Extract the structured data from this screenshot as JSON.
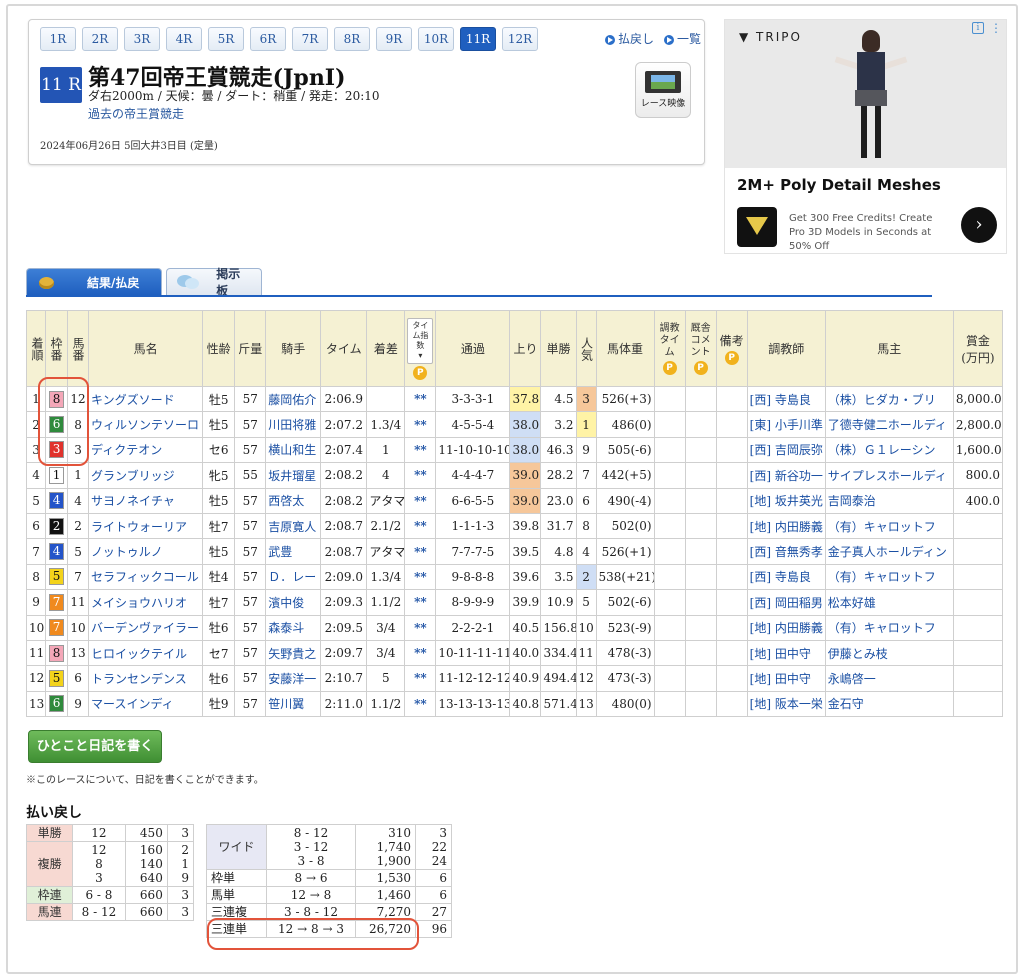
{
  "race_nav": {
    "tabs": [
      "1R",
      "2R",
      "3R",
      "4R",
      "5R",
      "6R",
      "7R",
      "8R",
      "9R",
      "10R",
      "11R",
      "12R"
    ],
    "active": "11R",
    "refund_link": "払戻し",
    "list_link": "一覧"
  },
  "race": {
    "badge": "11 R",
    "title": "第47回帝王賞競走(JpnI)",
    "info": "ダ右2000m / 天候：曇 / ダート：稍重 / 発走：20:10",
    "past_link": "過去の帝王賞競走",
    "date_line": "2024年06月26日 5回大井3日目 (定量)",
    "video_label": "レース映像"
  },
  "ad": {
    "brand": "TRIPO",
    "headline": "2M+ Poly Detail Meshes",
    "text": "Get 300 Free Credits! Create Pro 3D Models in Seconds at 50% Off",
    "go": "›"
  },
  "tabs": {
    "results": "結果/払戻",
    "board": "掲示板"
  },
  "table": {
    "headers": {
      "rank": "着順",
      "waku": "枠番",
      "uma": "馬番",
      "name": "馬名",
      "sex": "性齢",
      "weight": "斤量",
      "jockey": "騎手",
      "time": "タイム",
      "margin": "着差",
      "time_index": "タイム指数",
      "pass": "通過",
      "last": "上り",
      "odds": "単勝",
      "pop": "人気",
      "body": "馬体重",
      "train_time": "調教タイム",
      "stable_comment": "厩舎コメント",
      "note": "備考",
      "trainer": "調教師",
      "owner": "馬主",
      "prize": "賞金(万円)"
    },
    "rows": [
      {
        "rank": "1",
        "waku": "8",
        "uma": "12",
        "name": "キングズソード",
        "sex": "牡5",
        "kg": "57",
        "jockey": "藤岡佑介",
        "time": "2:06.9",
        "margin": "",
        "idx": "**",
        "pass": "3-3-3-1",
        "last": "37.8",
        "odds": "4.5",
        "pop": "3",
        "body": "526(+3)",
        "trainer": "[西] 寺島良",
        "owner": "（株）ヒダカ・ブリ",
        "prize": "8,000.0"
      },
      {
        "rank": "2",
        "waku": "6",
        "uma": "8",
        "name": "ウィルソンテソーロ",
        "sex": "牡5",
        "kg": "57",
        "jockey": "川田将雅",
        "time": "2:07.2",
        "margin": "1.3/4",
        "idx": "**",
        "pass": "4-5-5-4",
        "last": "38.0",
        "odds": "3.2",
        "pop": "1",
        "body": "486(0)",
        "trainer": "[東] 小手川準",
        "owner": "了德寺健二ホールディ",
        "prize": "2,800.0"
      },
      {
        "rank": "3",
        "waku": "3",
        "uma": "3",
        "name": "ディクテオン",
        "sex": "セ6",
        "kg": "57",
        "jockey": "横山和生",
        "time": "2:07.4",
        "margin": "1",
        "idx": "**",
        "pass": "11-10-10-10",
        "last": "38.0",
        "odds": "46.3",
        "pop": "9",
        "body": "505(-6)",
        "trainer": "[西] 吉岡辰弥",
        "owner": "（株）Ｇ１レーシン",
        "prize": "1,600.0"
      },
      {
        "rank": "4",
        "waku": "1",
        "uma": "1",
        "name": "グランブリッジ",
        "sex": "牝5",
        "kg": "55",
        "jockey": "坂井瑠星",
        "time": "2:08.2",
        "margin": "4",
        "idx": "**",
        "pass": "4-4-4-7",
        "last": "39.0",
        "odds": "28.2",
        "pop": "7",
        "body": "442(+5)",
        "trainer": "[西] 新谷功一",
        "owner": "サイプレスホールディ",
        "prize": "800.0"
      },
      {
        "rank": "5",
        "waku": "4",
        "uma": "4",
        "name": "サヨノネイチャ",
        "sex": "牡5",
        "kg": "57",
        "jockey": "西啓太",
        "time": "2:08.2",
        "margin": "アタマ",
        "idx": "**",
        "pass": "6-6-5-5",
        "last": "39.0",
        "odds": "23.0",
        "pop": "6",
        "body": "490(-4)",
        "trainer": "[地] 坂井英光",
        "owner": "吉岡泰治",
        "prize": "400.0"
      },
      {
        "rank": "6",
        "waku": "2",
        "uma": "2",
        "name": "ライトウォーリア",
        "sex": "牡7",
        "kg": "57",
        "jockey": "吉原寛人",
        "time": "2:08.7",
        "margin": "2.1/2",
        "idx": "**",
        "pass": "1-1-1-3",
        "last": "39.8",
        "odds": "31.7",
        "pop": "8",
        "body": "502(0)",
        "trainer": "[地] 内田勝義",
        "owner": "（有）キャロットフ",
        "prize": ""
      },
      {
        "rank": "7",
        "waku": "4",
        "uma": "5",
        "name": "ノットゥルノ",
        "sex": "牡5",
        "kg": "57",
        "jockey": "武豊",
        "time": "2:08.7",
        "margin": "アタマ",
        "idx": "**",
        "pass": "7-7-7-5",
        "last": "39.5",
        "odds": "4.8",
        "pop": "4",
        "body": "526(+1)",
        "trainer": "[西] 音無秀孝",
        "owner": "金子真人ホールディン",
        "prize": ""
      },
      {
        "rank": "8",
        "waku": "5",
        "uma": "7",
        "name": "セラフィックコール",
        "sex": "牡4",
        "kg": "57",
        "jockey": "Ｄ．レー",
        "time": "2:09.0",
        "margin": "1.3/4",
        "idx": "**",
        "pass": "9-8-8-8",
        "last": "39.6",
        "odds": "3.5",
        "pop": "2",
        "body": "538(+21)",
        "trainer": "[西] 寺島良",
        "owner": "（有）キャロットフ",
        "prize": ""
      },
      {
        "rank": "9",
        "waku": "7",
        "uma": "11",
        "name": "メイショウハリオ",
        "sex": "牡7",
        "kg": "57",
        "jockey": "濱中俊",
        "time": "2:09.3",
        "margin": "1.1/2",
        "idx": "**",
        "pass": "8-9-9-9",
        "last": "39.9",
        "odds": "10.9",
        "pop": "5",
        "body": "502(-6)",
        "trainer": "[西] 岡田稲男",
        "owner": "松本好雄",
        "prize": ""
      },
      {
        "rank": "10",
        "waku": "7",
        "uma": "10",
        "name": "バーデンヴァイラー",
        "sex": "牡6",
        "kg": "57",
        "jockey": "森泰斗",
        "time": "2:09.5",
        "margin": "3/4",
        "idx": "**",
        "pass": "2-2-2-1",
        "last": "40.5",
        "odds": "156.8",
        "pop": "10",
        "body": "523(-9)",
        "trainer": "[地] 内田勝義",
        "owner": "（有）キャロットフ",
        "prize": ""
      },
      {
        "rank": "11",
        "waku": "8",
        "uma": "13",
        "name": "ヒロイックテイル",
        "sex": "セ7",
        "kg": "57",
        "jockey": "矢野貴之",
        "time": "2:09.7",
        "margin": "3/4",
        "idx": "**",
        "pass": "10-11-11-11",
        "last": "40.0",
        "odds": "334.4",
        "pop": "11",
        "body": "478(-3)",
        "trainer": "[地] 田中守",
        "owner": "伊藤とみ枝",
        "prize": ""
      },
      {
        "rank": "12",
        "waku": "5",
        "uma": "6",
        "name": "トランセンデンス",
        "sex": "牡6",
        "kg": "57",
        "jockey": "安藤洋一",
        "time": "2:10.7",
        "margin": "5",
        "idx": "**",
        "pass": "11-12-12-12",
        "last": "40.9",
        "odds": "494.4",
        "pop": "12",
        "body": "473(-3)",
        "trainer": "[地] 田中守",
        "owner": "永嶋啓一",
        "prize": ""
      },
      {
        "rank": "13",
        "waku": "6",
        "uma": "9",
        "name": "マースインディ",
        "sex": "牡9",
        "kg": "57",
        "jockey": "笹川翼",
        "time": "2:11.0",
        "margin": "1.1/2",
        "idx": "**",
        "pass": "13-13-13-13",
        "last": "40.8",
        "odds": "571.4",
        "pop": "13",
        "body": "480(0)",
        "trainer": "[地] 阪本一栄",
        "owner": "金石守",
        "prize": ""
      }
    ]
  },
  "diary": {
    "button": "ひとこと日記を書く",
    "note": "※このレースについて、日記を書くことができます。"
  },
  "payout": {
    "title": "払い戻し",
    "left": {
      "tan": {
        "label": "単勝",
        "nums": [
          "12"
        ],
        "pays": [
          "450"
        ],
        "pops": [
          "3"
        ]
      },
      "fuku": {
        "label": "複勝",
        "nums": [
          "12",
          "8",
          "3"
        ],
        "pays": [
          "160",
          "140",
          "640"
        ],
        "pops": [
          "2",
          "1",
          "9"
        ]
      },
      "waku": {
        "label": "枠連",
        "nums": [
          "6 - 8"
        ],
        "pays": [
          "660"
        ],
        "pops": [
          "3"
        ]
      },
      "uma": {
        "label": "馬連",
        "nums": [
          "8 - 12"
        ],
        "pays": [
          "660"
        ],
        "pops": [
          "3"
        ]
      }
    },
    "right": {
      "wide": {
        "label": "ワイド",
        "nums": [
          "8 - 12",
          "3 - 12",
          "3 - 8"
        ],
        "pays": [
          "310",
          "1,740",
          "1,900"
        ],
        "pops": [
          "3",
          "22",
          "24"
        ]
      },
      "wakutan": {
        "label": "枠単",
        "nums": [
          "8 → 6"
        ],
        "pays": [
          "1,530"
        ],
        "pops": [
          "6"
        ]
      },
      "umatan": {
        "label": "馬単",
        "nums": [
          "12 → 8"
        ],
        "pays": [
          "1,460"
        ],
        "pops": [
          "6"
        ]
      },
      "sanfuku": {
        "label": "三連複",
        "nums": [
          "3 - 8 - 12"
        ],
        "pays": [
          "7,270"
        ],
        "pops": [
          "27"
        ]
      },
      "santan": {
        "label": "三連単",
        "nums": [
          "12 → 8 → 3"
        ],
        "pays": [
          "26,720"
        ],
        "pops": [
          "96"
        ]
      }
    }
  },
  "colors": {
    "waku1": "#ffffff",
    "waku2": "#111111",
    "waku3": "#e0322c",
    "waku4": "#2454c9",
    "waku5": "#f3d31b",
    "waku6": "#2f8a3c",
    "waku7": "#f08a1e",
    "waku8": "#f4a7b8"
  }
}
